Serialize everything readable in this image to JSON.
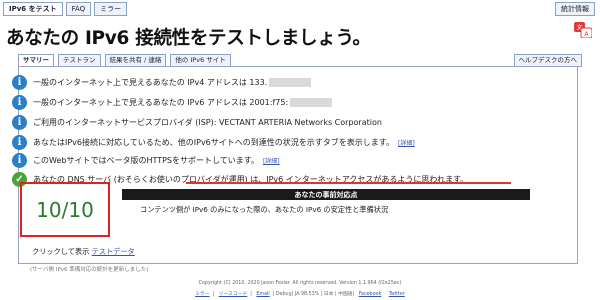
{
  "nav": {
    "tabs": [
      "IPv6 をテスト",
      "FAQ",
      "ミラー"
    ],
    "stats": "統計情報"
  },
  "page": {
    "title": "あなたの IPv6 接続性をテストしましょう。"
  },
  "subtabs": [
    "サマリー",
    "テストラン",
    "結果を共有 / 連絡",
    "他の IPv6 サイト"
  ],
  "helpdesk": "ヘルプデスクの方へ",
  "rows": [
    {
      "icon": "i",
      "text": "一般のインターネット上で見えるあなたの IPv4 アドレスは 133."
    },
    {
      "icon": "i",
      "text": "一般のインターネット上で見えるあなたの IPv6 アドレスは 2001:f75:"
    },
    {
      "icon": "i",
      "text": "ご利用のインターネットサービスプロバイダ (ISP): VECTANT ARTERIA Networks Corporation"
    },
    {
      "icon": "i",
      "text": "あなたはIPv6接続に対応しているため、他のIPv6サイトへの到達性の状況を示すタブを表示します。",
      "detail": "[詳細]"
    },
    {
      "icon": "i",
      "text": "このWebサイトではベータ版のHTTPSをサポートしています。",
      "detail": "[詳細]"
    },
    {
      "icon": "ok",
      "text": "あなたの DNS サーバ (おそらくお使いのプロバイダが運用) は、IPv6 インターネットアクセスがあるように思われます。"
    }
  ],
  "readiness": {
    "header": "あなたの事前対応点",
    "score": "10/10",
    "description": "コンテンツ側が IPv6 のみになった際の、あなたの IPv6 の安定性と準備状況"
  },
  "testdata": {
    "prefix": "クリックして表示",
    "link": "テストデータ"
  },
  "note": "(サーバ側 IPv6 準備対応の統計を更新しました)",
  "footer": {
    "copyright": "Copyright (C) 2010, 2020 Jason Fesler. All rights reserved. Version 1.1.964 (f2e25ec)",
    "links": [
      "ミラー",
      "ソースコード",
      "Email",
      "",
      "",
      "",
      "Facebook",
      "Twitter"
    ],
    "mid_text": "Debug",
    "stat_text": "JA 98.53% | 日本 | 中国語"
  }
}
